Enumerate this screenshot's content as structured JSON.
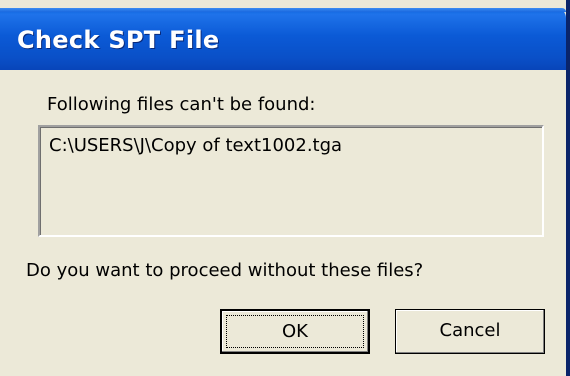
{
  "dialog": {
    "title": "Check SPT File",
    "message_label": "Following files can't be found:",
    "missing_files": [
      "C:\\USERS\\J\\Copy of text1002.tga"
    ],
    "question": "Do you want to proceed without these files?",
    "buttons": {
      "ok_label": "OK",
      "cancel_label": "Cancel"
    }
  },
  "colors": {
    "titlebar": "#0a50c8",
    "dialog_background": "#ece9d8",
    "title_text": "#ffffff"
  }
}
